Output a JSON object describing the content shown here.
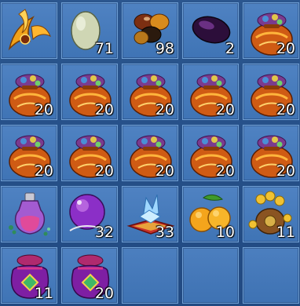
{
  "inventory": {
    "slots": [
      {
        "item": "flame-crescent-icon",
        "qty": ""
      },
      {
        "item": "jade-egg-icon",
        "qty": "71"
      },
      {
        "item": "gem-stones-icon",
        "qty": "98"
      },
      {
        "item": "purple-gem-icon",
        "qty": "2"
      },
      {
        "item": "treasure-bag-icon",
        "qty": "20"
      },
      {
        "item": "treasure-bag-icon",
        "qty": "20"
      },
      {
        "item": "treasure-bag-icon",
        "qty": "20"
      },
      {
        "item": "treasure-bag-icon",
        "qty": "20"
      },
      {
        "item": "treasure-bag-icon",
        "qty": "20"
      },
      {
        "item": "treasure-bag-icon",
        "qty": "20"
      },
      {
        "item": "treasure-bag-icon",
        "qty": "20"
      },
      {
        "item": "treasure-bag-icon",
        "qty": "20"
      },
      {
        "item": "treasure-bag-icon",
        "qty": "20"
      },
      {
        "item": "treasure-bag-icon",
        "qty": "20"
      },
      {
        "item": "treasure-bag-icon",
        "qty": "20"
      },
      {
        "item": "potion-flask-icon",
        "qty": ""
      },
      {
        "item": "crystal-orb-icon",
        "qty": "32"
      },
      {
        "item": "ice-crystal-cushion-icon",
        "qty": "33"
      },
      {
        "item": "orange-fruit-icon",
        "qty": "10"
      },
      {
        "item": "coin-pouch-icon",
        "qty": "11"
      },
      {
        "item": "purple-pouch-icon",
        "qty": "11"
      },
      {
        "item": "purple-pouch-icon",
        "qty": "20"
      },
      {
        "item": "",
        "qty": ""
      },
      {
        "item": "",
        "qty": ""
      },
      {
        "item": "",
        "qty": ""
      }
    ]
  }
}
